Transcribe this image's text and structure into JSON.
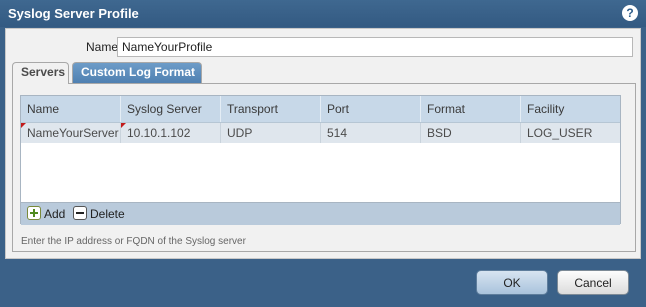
{
  "window": {
    "title": "Syslog Server Profile",
    "help_icon": "?"
  },
  "form": {
    "name_label": "Name",
    "name_value": "NameYourProfile"
  },
  "tabs": [
    {
      "label": "Servers"
    },
    {
      "label": "Custom Log Format"
    }
  ],
  "table": {
    "columns": [
      "Name",
      "Syslog Server",
      "Transport",
      "Port",
      "Format",
      "Facility"
    ],
    "rows": [
      [
        "NameYourServer",
        "10.10.1.102",
        "UDP",
        "514",
        "BSD",
        "LOG_USER"
      ]
    ]
  },
  "toolbar": {
    "add_label": "Add",
    "delete_label": "Delete"
  },
  "hint": "Enter the IP address or FQDN of the Syslog server",
  "buttons": {
    "ok": "OK",
    "cancel": "Cancel"
  },
  "colors": {
    "title_bar": "#3b6188",
    "grid_header": "#c7d8e8",
    "active_tab": "#f1f1f1",
    "inactive_tab": "#5a8bbb",
    "selected_row": "#dfe6ed"
  }
}
